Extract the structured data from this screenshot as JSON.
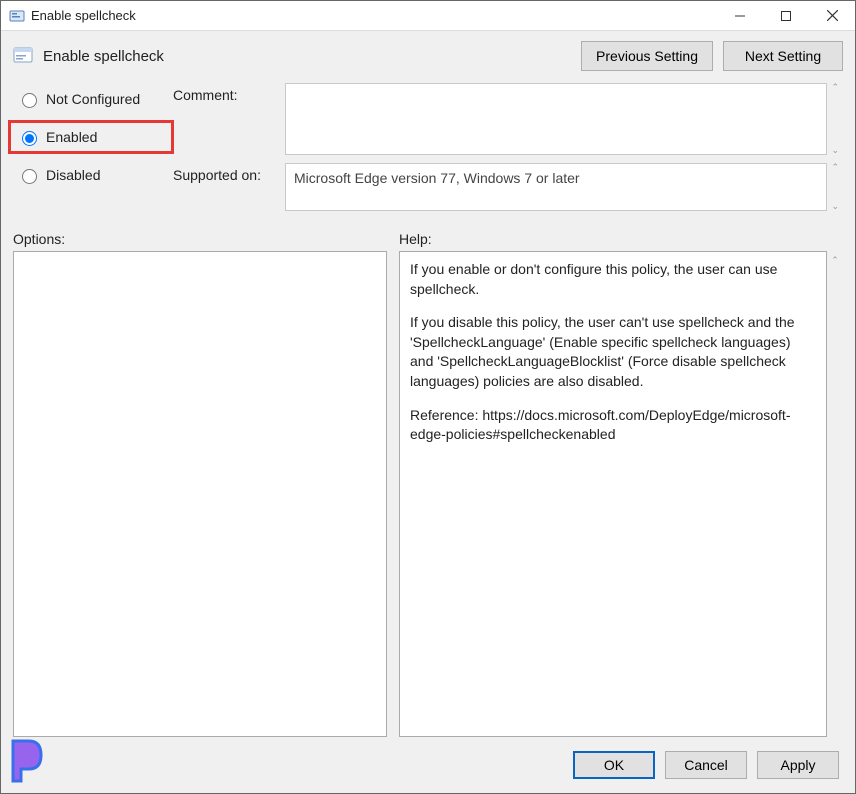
{
  "window": {
    "title": "Enable spellcheck"
  },
  "header": {
    "policy_title": "Enable spellcheck",
    "prev_button": "Previous Setting",
    "next_button": "Next Setting"
  },
  "radios": {
    "not_configured": "Not Configured",
    "enabled": "Enabled",
    "disabled": "Disabled",
    "selected": "enabled"
  },
  "labels": {
    "comment": "Comment:",
    "supported_on": "Supported on:",
    "options": "Options:",
    "help": "Help:"
  },
  "fields": {
    "comment_value": "",
    "supported_on_value": "Microsoft Edge version 77, Windows 7 or later"
  },
  "help_text": {
    "p1": "If you enable or don't configure this policy, the user can use spellcheck.",
    "p2": "If you disable this policy, the user can't use spellcheck and the 'SpellcheckLanguage' (Enable specific spellcheck languages) and 'SpellcheckLanguageBlocklist' (Force disable spellcheck languages) policies are also disabled.",
    "p3": "Reference: https://docs.microsoft.com/DeployEdge/microsoft-edge-policies#spellcheckenabled"
  },
  "buttons": {
    "ok": "OK",
    "cancel": "Cancel",
    "apply": "Apply"
  }
}
